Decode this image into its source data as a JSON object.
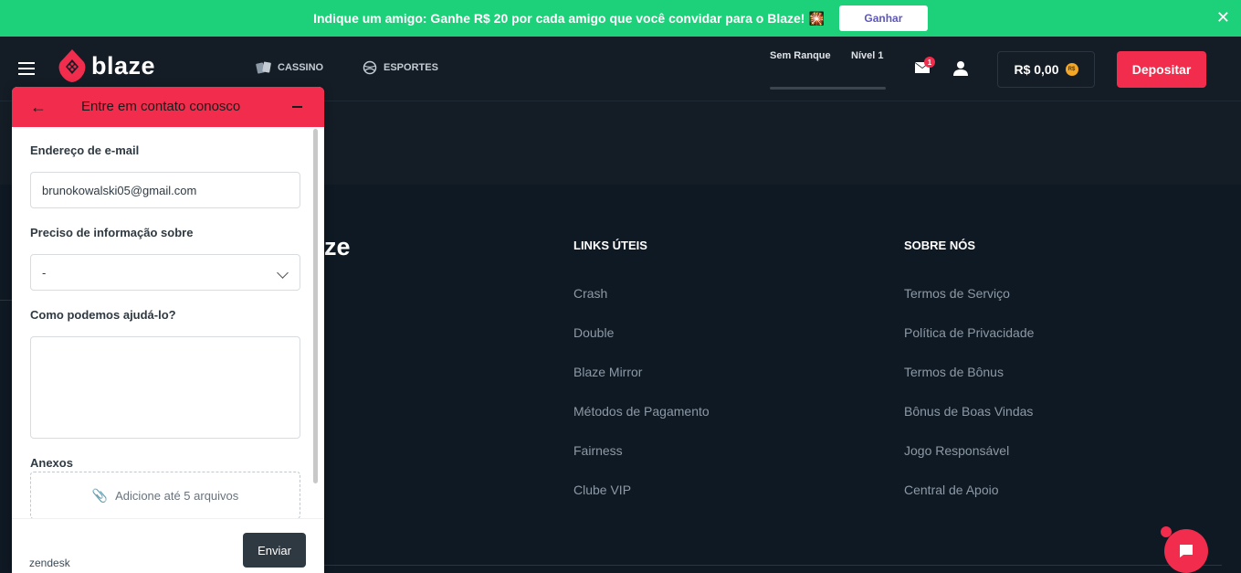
{
  "promo": {
    "text": "Indique um amigo: Ganhe R$ 20 por cada amigo que você convidar para o Blaze!",
    "emoji": "🎇",
    "button": "Ganhar",
    "close": "✕"
  },
  "header": {
    "logo": "blaze",
    "nav": [
      {
        "label": "CASSINO",
        "icon": "cards-icon"
      },
      {
        "label": "ESPORTES",
        "icon": "ball-icon"
      }
    ],
    "rank": "Sem Ranque",
    "level": "Nível 1",
    "inbox_badge": "1",
    "balance": "R$ 0,00",
    "coin_label": "R$",
    "deposit": "Depositar"
  },
  "footer": {
    "logo_fragment": "ze",
    "columns": [
      {
        "title": "LINKS ÚTEIS",
        "links": [
          "Crash",
          "Double",
          "Blaze Mirror",
          "Métodos de Pagamento",
          "Fairness",
          "Clube VIP"
        ]
      },
      {
        "title": "SOBRE NÓS",
        "links": [
          "Termos de Serviço",
          "Política de Privacidade",
          "Termos de Bônus",
          "Bônus de Boas Vindas",
          "Jogo Responsável",
          "Central de Apoio"
        ]
      }
    ]
  },
  "widget": {
    "title": "Entre em contato conosco",
    "email_label": "Endereço de e-mail",
    "email_value": "brunokowalski05@gmail.com",
    "topic_label": "Preciso de informação sobre",
    "topic_value": "-",
    "help_label": "Como podemos ajudá-lo?",
    "help_value": "",
    "attachments_label": "Anexos",
    "upload_text": "Adicione até 5 arquivos",
    "brand": "zendesk",
    "send": "Enviar"
  },
  "colors": {
    "accent": "#f12c4c",
    "promo": "#1cd17a",
    "background": "#0f1923",
    "header": "#141d26"
  }
}
